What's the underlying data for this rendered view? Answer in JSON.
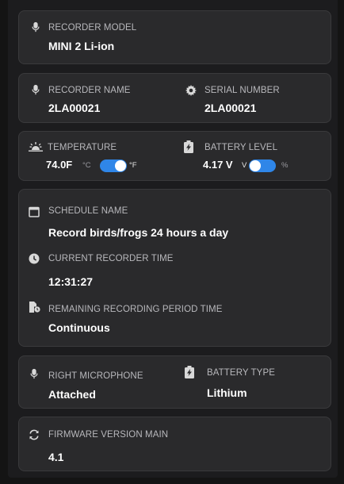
{
  "recorder_model": {
    "label": "RECORDER MODEL",
    "value": "MINI 2 Li-ion",
    "icon": "microphone-icon"
  },
  "recorder_name": {
    "label": "RECORDER NAME",
    "value": "2LA00021",
    "icon": "microphone-icon"
  },
  "serial_number": {
    "label": "SERIAL NUMBER",
    "value": "2LA00021",
    "icon": "gear-icon"
  },
  "temperature": {
    "label": "TEMPERATURE",
    "value": "74.0F",
    "icon": "sunrise-icon",
    "unit_left": "°C",
    "unit_right": "°F",
    "toggle_on": true,
    "toggle_color": "#2f86e8"
  },
  "battery_level": {
    "label": "BATTERY LEVEL",
    "value": "4.17 V",
    "icon": "battery-charge-icon",
    "unit_left": "V",
    "unit_right": "%",
    "toggle_on": false,
    "toggle_color": "#2f86e8"
  },
  "schedule_name": {
    "label": "SCHEDULE NAME",
    "value": "Record birds/frogs 24 hours a day",
    "icon": "calendar-icon"
  },
  "current_time": {
    "label": "CURRENT RECORDER TIME",
    "value": "12:31:27",
    "icon": "clock-icon"
  },
  "remaining_time": {
    "label": "REMAINING RECORDING PERIOD TIME",
    "value": "Continuous",
    "icon": "document-clock-icon"
  },
  "right_microphone": {
    "label": "RIGHT MICROPHONE",
    "value": "Attached",
    "icon": "microphone-icon"
  },
  "battery_type": {
    "label": "BATTERY TYPE",
    "value": "Lithium",
    "icon": "battery-charge-icon"
  },
  "firmware": {
    "label": "FIRMWARE VERSION MAIN",
    "value": "4.1",
    "icon": "sync-icon"
  }
}
